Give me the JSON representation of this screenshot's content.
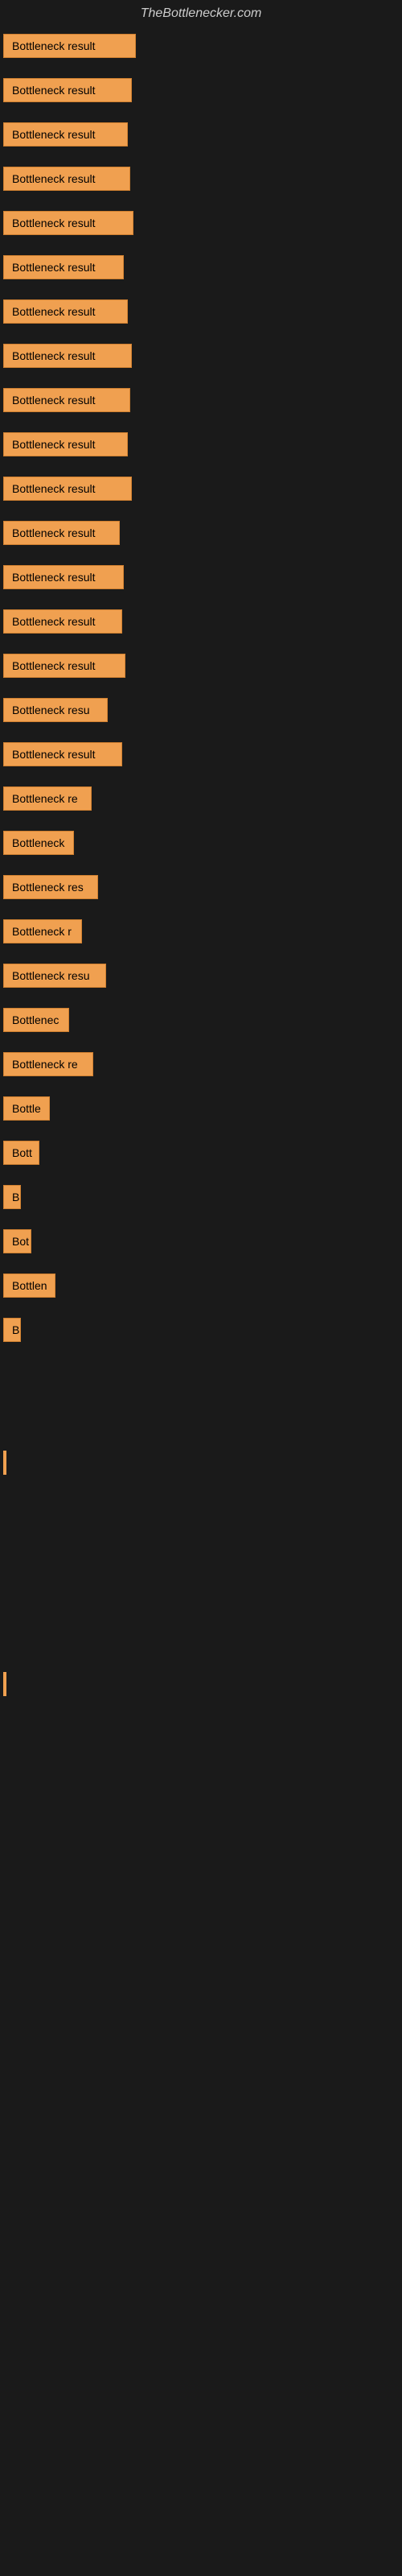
{
  "site": {
    "title": "TheBottlenecker.com"
  },
  "items": [
    {
      "label": "Bottleneck result",
      "width": 165,
      "visible": true
    },
    {
      "label": "Bottleneck result",
      "width": 160,
      "visible": true
    },
    {
      "label": "Bottleneck result",
      "width": 155,
      "visible": true
    },
    {
      "label": "Bottleneck result",
      "width": 158,
      "visible": true
    },
    {
      "label": "Bottleneck result",
      "width": 162,
      "visible": true
    },
    {
      "label": "Bottleneck result",
      "width": 150,
      "visible": true
    },
    {
      "label": "Bottleneck result",
      "width": 155,
      "visible": true
    },
    {
      "label": "Bottleneck result",
      "width": 160,
      "visible": true
    },
    {
      "label": "Bottleneck result",
      "width": 158,
      "visible": true
    },
    {
      "label": "Bottleneck result",
      "width": 155,
      "visible": true
    },
    {
      "label": "Bottleneck result",
      "width": 160,
      "visible": true
    },
    {
      "label": "Bottleneck result",
      "width": 145,
      "visible": true
    },
    {
      "label": "Bottleneck result",
      "width": 150,
      "visible": true
    },
    {
      "label": "Bottleneck result",
      "width": 148,
      "visible": true
    },
    {
      "label": "Bottleneck result",
      "width": 152,
      "visible": true
    },
    {
      "label": "Bottleneck resu",
      "width": 130,
      "visible": true
    },
    {
      "label": "Bottleneck result",
      "width": 148,
      "visible": true
    },
    {
      "label": "Bottleneck re",
      "width": 110,
      "visible": true
    },
    {
      "label": "Bottleneck",
      "width": 88,
      "visible": true
    },
    {
      "label": "Bottleneck res",
      "width": 118,
      "visible": true
    },
    {
      "label": "Bottleneck r",
      "width": 98,
      "visible": true
    },
    {
      "label": "Bottleneck resu",
      "width": 128,
      "visible": true
    },
    {
      "label": "Bottlenec",
      "width": 82,
      "visible": true
    },
    {
      "label": "Bottleneck re",
      "width": 112,
      "visible": true
    },
    {
      "label": "Bottle",
      "width": 58,
      "visible": true
    },
    {
      "label": "Bott",
      "width": 45,
      "visible": true
    },
    {
      "label": "B",
      "width": 20,
      "visible": true
    },
    {
      "label": "Bot",
      "width": 35,
      "visible": true
    },
    {
      "label": "Bottlen",
      "width": 65,
      "visible": true
    },
    {
      "label": "B",
      "width": 18,
      "visible": true
    },
    {
      "label": "",
      "width": 0,
      "visible": false
    },
    {
      "label": "",
      "width": 0,
      "visible": false
    },
    {
      "label": "|",
      "width": 8,
      "visible": true
    },
    {
      "label": "",
      "width": 0,
      "visible": false
    },
    {
      "label": "",
      "width": 0,
      "visible": false
    },
    {
      "label": "",
      "width": 0,
      "visible": false
    },
    {
      "label": "",
      "width": 0,
      "visible": false
    },
    {
      "label": "|",
      "width": 8,
      "visible": true
    }
  ]
}
